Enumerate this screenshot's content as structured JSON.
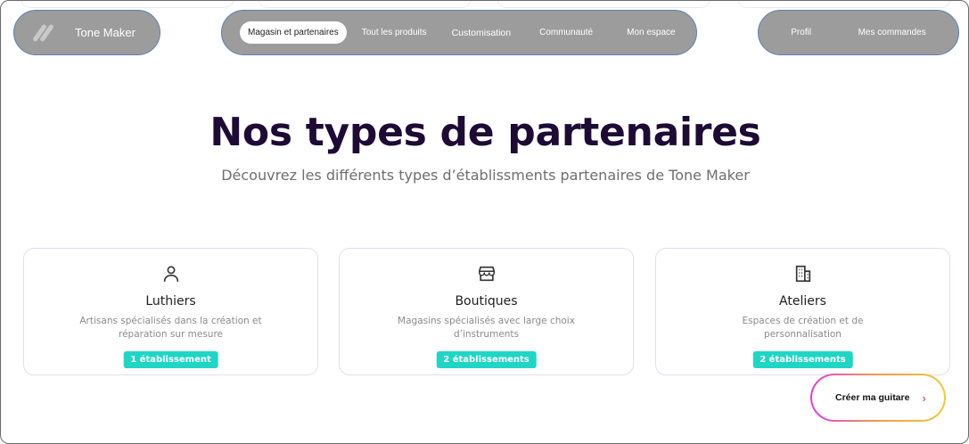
{
  "brand": {
    "name": "Tone Maker"
  },
  "nav": {
    "items": [
      "Magasin et partenaires",
      "Tout les produits",
      "Customisation",
      "Communauté",
      "Mon espace"
    ],
    "active_index": 0
  },
  "user_nav": {
    "items": [
      "Profil",
      "Mes commandes"
    ]
  },
  "hero": {
    "title": "Nos types de partenaires",
    "subtitle": "Découvrez les différents types d’établissments partenaires de Tone Maker"
  },
  "cards": [
    {
      "icon": "person-icon",
      "title": "Luthiers",
      "desc": "Artisans spécialisés dans la création et réparation sur mesure",
      "badge": "1 établissement"
    },
    {
      "icon": "store-icon",
      "title": "Boutiques",
      "desc": "Magasins spécialisés avec large choix d’instruments",
      "badge": "2 établissements"
    },
    {
      "icon": "building-icon",
      "title": "Ateliers",
      "desc": "Espaces de création et de personnalisation",
      "badge": "2 établissements"
    }
  ],
  "cta": {
    "label": "Créer ma guitare",
    "icon": "chevron-right-icon"
  },
  "colors": {
    "accent": "#1fd6c6",
    "title": "#1d0b35",
    "nav_bg": "#9c9c9c"
  }
}
